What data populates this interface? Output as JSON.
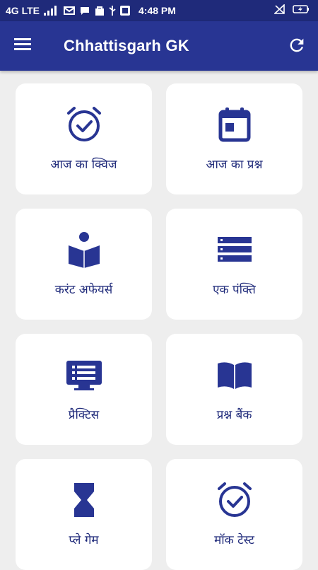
{
  "status_bar": {
    "network": "4G LTE",
    "time": "4:48 PM"
  },
  "app_bar": {
    "title": "Chhattisgarh GK",
    "menu_icon": "hamburger-menu-icon",
    "refresh_icon": "refresh-icon"
  },
  "colors": {
    "primary": "#283593",
    "status_bar": "#1f2a7a",
    "icon": "#283593",
    "card_bg": "#ffffff",
    "page_bg": "#eeeeee"
  },
  "cards": [
    {
      "label": "आज का क्विज",
      "icon": "alarm-clock-check-icon"
    },
    {
      "label": "आज का प्रश्न",
      "icon": "calendar-icon"
    },
    {
      "label": "करंट अफेयर्स",
      "icon": "reading-person-icon"
    },
    {
      "label": "एक पंक्ति",
      "icon": "list-icon"
    },
    {
      "label": "प्रैक्टिस",
      "icon": "monitor-list-icon"
    },
    {
      "label": "प्रश्न बैंक",
      "icon": "open-book-icon"
    },
    {
      "label": "प्ले गेम",
      "icon": "hourglass-icon"
    },
    {
      "label": "मॉक टेस्ट",
      "icon": "alarm-clock-check-icon"
    }
  ]
}
